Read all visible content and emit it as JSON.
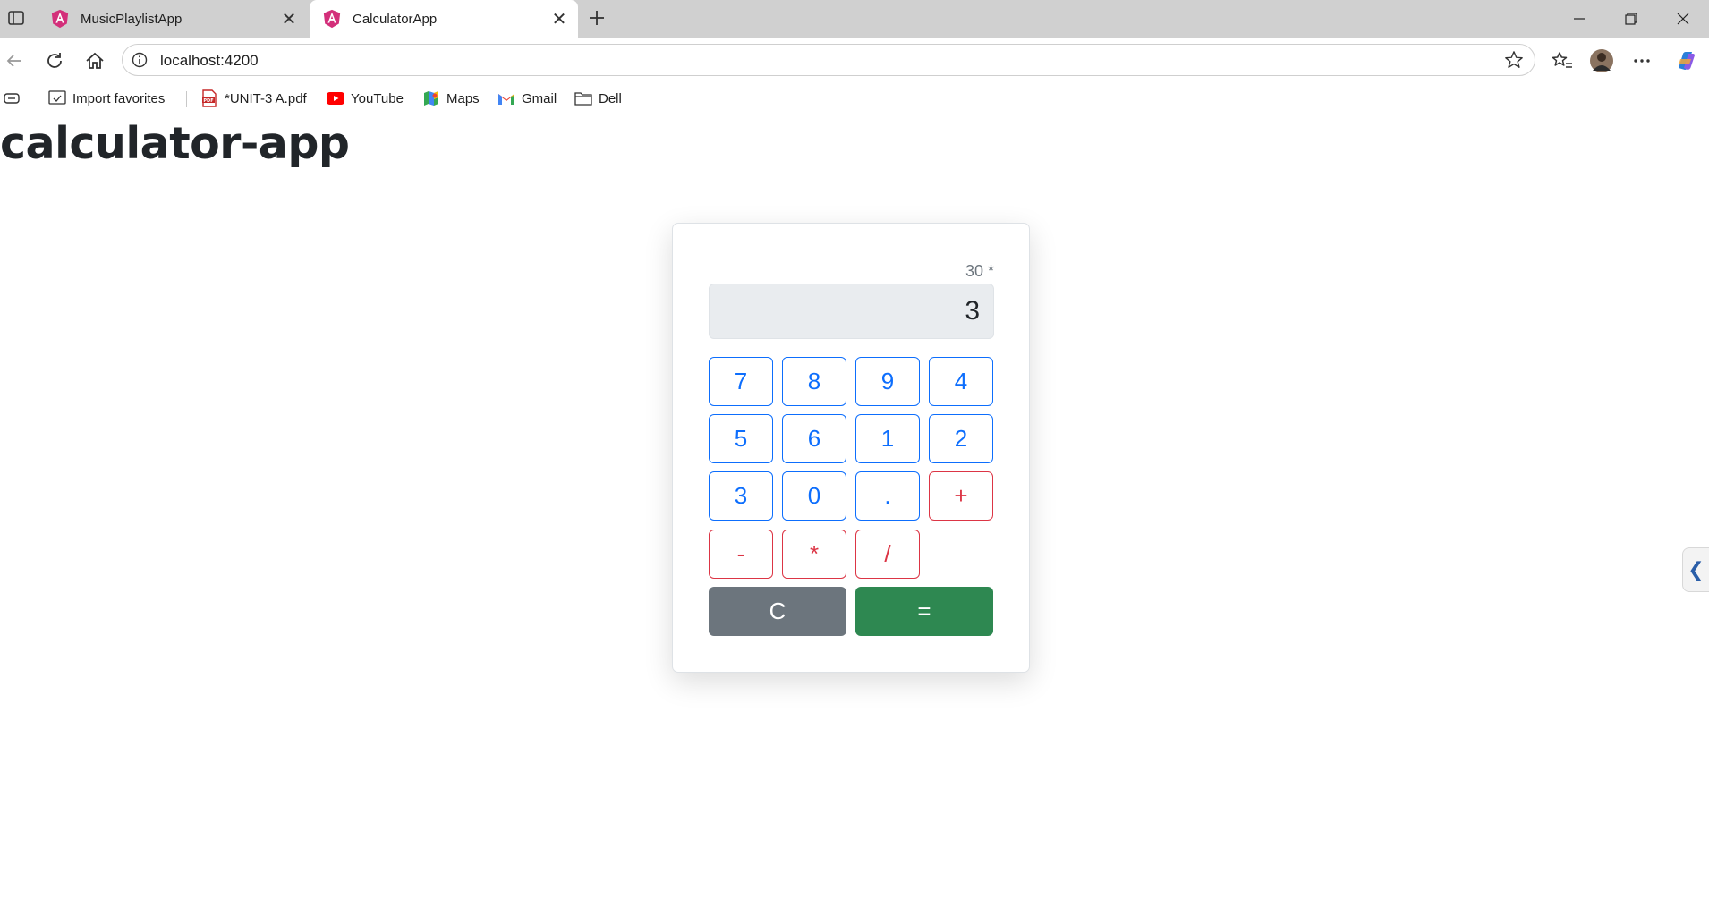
{
  "browser": {
    "tabs": [
      {
        "label": "MusicPlaylistApp",
        "active": false
      },
      {
        "label": "CalculatorApp",
        "active": true
      }
    ],
    "address": "localhost:4200",
    "bookmarks": [
      {
        "label": "Import favorites",
        "icon": "import-icon"
      },
      {
        "label": "*UNIT-3 A.pdf",
        "icon": "pdf-icon"
      },
      {
        "label": "YouTube",
        "icon": "youtube-icon"
      },
      {
        "label": "Maps",
        "icon": "maps-icon"
      },
      {
        "label": "Gmail",
        "icon": "gmail-icon"
      },
      {
        "label": "Dell",
        "icon": "folder-icon"
      }
    ]
  },
  "page": {
    "title": "calculator-app"
  },
  "calculator": {
    "history": "30 *",
    "display": "3",
    "keys": {
      "k7": "7",
      "k8": "8",
      "k9": "9",
      "k4": "4",
      "k5": "5",
      "k6": "6",
      "k1": "1",
      "k2": "2",
      "k3": "3",
      "k0": "0",
      "kdot": ".",
      "kplus": "+",
      "kminus": "-",
      "kmul": "*",
      "kdiv": "/"
    },
    "clear_label": "C",
    "equals_label": "=",
    "colors": {
      "number_key": "#0d6efd",
      "operator_key": "#dc3545",
      "clear": "#6c757d",
      "equals": "#2e8851"
    }
  },
  "sidebar_toggle": "❮"
}
